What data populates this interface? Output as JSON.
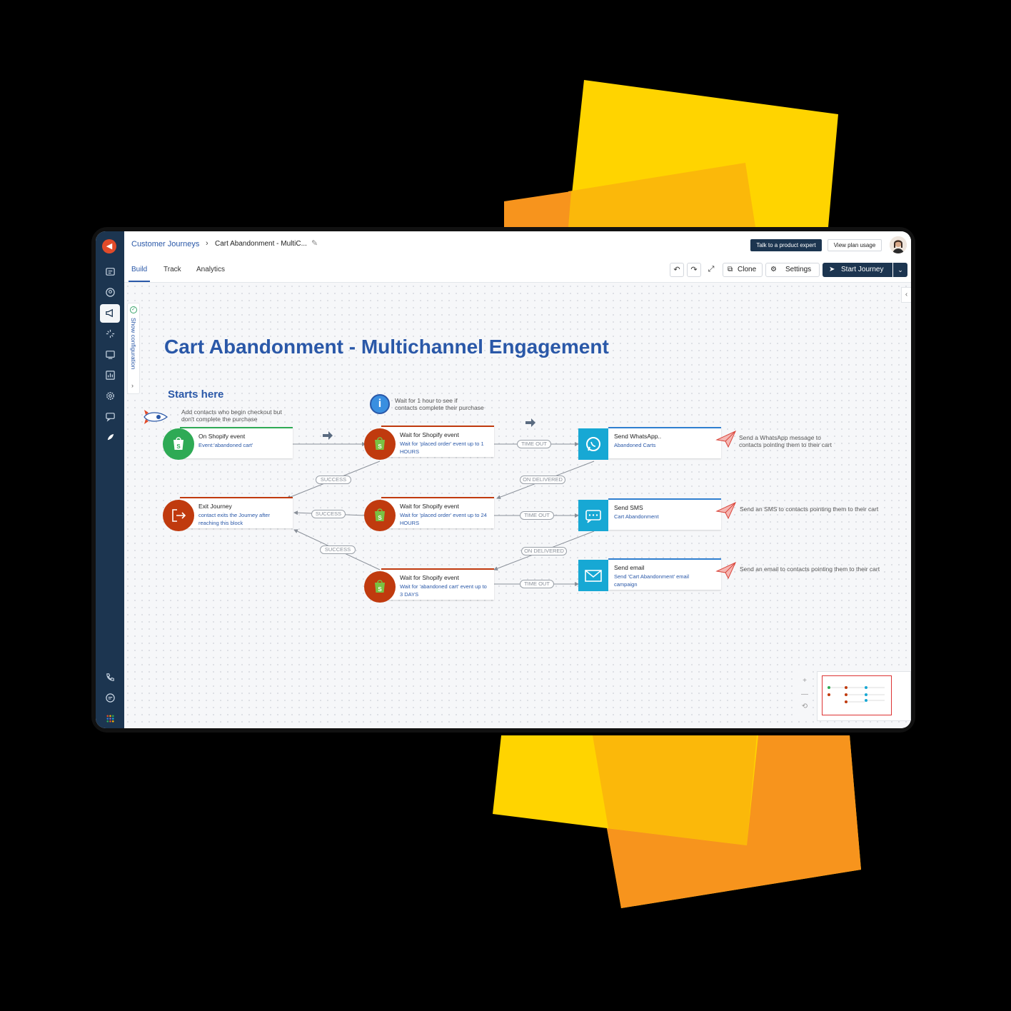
{
  "app": {
    "breadcrumb": {
      "parent": "Customer Journeys",
      "separator": "›",
      "current": "Cart Abandonment - MultiC..."
    },
    "header_buttons": {
      "expert": "Talk to a product expert",
      "plan": "View plan usage"
    },
    "tabs": [
      "Build",
      "Track",
      "Analytics"
    ],
    "toolbar": {
      "clone": "Clone",
      "settings": "Settings",
      "start": "Start Journey"
    },
    "config_tab": "Show configuration",
    "nav_icons": [
      "logo-icon",
      "inbox-icon",
      "contacts-icon",
      "campaigns-icon",
      "automation-icon",
      "landing-pages-icon",
      "reports-icon",
      "settings-icon",
      "conversations-icon",
      "rocket-icon",
      "phone-icon",
      "chat-icon",
      "apps-icon"
    ]
  },
  "canvas": {
    "title": "Cart Abandonment - Multichannel Engagement",
    "starts_here": "Starts here",
    "notes": {
      "start": "Add contacts who begin checkout but\ndon't complete the purchase",
      "wait": "Wait for 1 hour to see if\ncontacts complete their purchase",
      "whatsapp": "Send a WhatsApp message to\ncontacts pointing them to their cart",
      "sms": "Send an SMS to contacts pointing them to their cart",
      "email": "Send an email to contacts pointing them to their cart"
    },
    "nodes": {
      "trigger": {
        "title": "On Shopify event",
        "sub": "Event:'abandoned cart'"
      },
      "wait1": {
        "title": "Wait for Shopify event",
        "sub": "Wait for 'placed order' event up to 1 HOURS"
      },
      "wait2": {
        "title": "Wait for Shopify event",
        "sub": "Wait for 'placed order' event up to 24 HOURS"
      },
      "wait3": {
        "title": "Wait for Shopify event",
        "sub": "Wait for 'abandoned cart' event up to 3 DAYS"
      },
      "exit": {
        "title": "Exit Journey",
        "sub": "contact exits the Journey after reaching this block"
      },
      "whatsapp": {
        "title": "Send WhatsApp..",
        "sub": "Abandoned Carts"
      },
      "sms": {
        "title": "Send SMS",
        "sub": "Cart Abandonment"
      },
      "email": {
        "title": "Send email",
        "sub": "Send 'Cart Abandonment' email campaign"
      }
    },
    "pills": {
      "timeout1": "TIME OUT",
      "success1": "SUCCESS",
      "delivered1": "ON DELIVERED",
      "success2": "SUCCESS",
      "timeout2": "TIME OUT",
      "success3": "SUCCESS",
      "delivered2": "ON DELIVERED",
      "timeout3": "TIME OUT"
    },
    "zoom": {
      "in": "+",
      "out": "—",
      "reset": "⟲"
    }
  },
  "colors": {
    "navy": "#1c3550",
    "brand_blue": "#2a58a8",
    "shopify_red": "#c03a0e",
    "channel_cyan": "#17a8d4",
    "trigger_green": "#2eaa55",
    "accent_yellow": "#ffd400",
    "accent_orange": "#f7941d"
  }
}
